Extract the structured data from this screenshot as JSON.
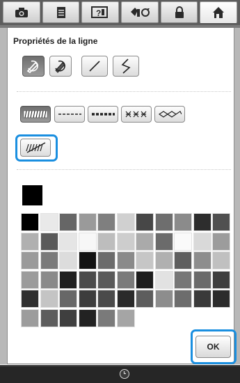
{
  "toolbar": {
    "tabs": [
      {
        "icon": "camera-icon"
      },
      {
        "icon": "page-icon"
      },
      {
        "icon": "help-icon"
      },
      {
        "icon": "settings-icon"
      },
      {
        "icon": "lock-icon"
      },
      {
        "icon": "home-icon",
        "active": true
      }
    ]
  },
  "dialog": {
    "title": "Propriétés de la ligne",
    "tools": [
      {
        "icon": "pen-select-icon",
        "selected": true
      },
      {
        "icon": "pen-fill-icon",
        "selected": false
      },
      {
        "icon": "straight-line-icon",
        "selected": false
      },
      {
        "icon": "zigzag-line-icon",
        "selected": false
      }
    ],
    "stitch_types": [
      {
        "icon": "satin-stitch-icon",
        "selected": true
      },
      {
        "icon": "running-stitch-icon",
        "selected": false
      },
      {
        "icon": "triple-stitch-icon",
        "selected": false
      },
      {
        "icon": "cross-stitch-icon",
        "selected": false
      },
      {
        "icon": "candlewick-stitch-icon",
        "selected": false
      },
      {
        "icon": "no-stitch-icon",
        "selected": false,
        "highlighted": true
      }
    ],
    "current_color": "#000000",
    "palette": [
      "#000000",
      "#e9e9e9",
      "#666666",
      "#9a9a9a",
      "#7f7f7f",
      "#d0d0d0",
      "#474747",
      "#6e6e6e",
      "#8b8b8b",
      "#2d2d2d",
      "#505050",
      "#b0b0b0",
      "#5a5a5a",
      "#e5e5e5",
      "#f7f7f7",
      "#bdbdbd",
      "#cdcdcd",
      "#aaaaaa",
      "#6b6b6b",
      "#fafafa",
      "#d9d9d9",
      "#9c9c9c",
      "#9a9a9a",
      "#7a7a7a",
      "#dcdcdc",
      "#121212",
      "#6c6c6c",
      "#8a8a8a",
      "#c6c6c6",
      "#b0b0b0",
      "#5e5e5e",
      "#8d8d8d",
      "#c0c0c0",
      "#9b9b9b",
      "#8a8a8a",
      "#202020",
      "#4b4b4b",
      "#5a5a5a",
      "#7a7a7a",
      "#1d1d1d",
      "#e2e2e2",
      "#777777",
      "#6a6a6a",
      "#3e3e3e",
      "#2f2f2f",
      "#c4c4c4",
      "#676767",
      "#3d3d3d",
      "#4a4a4a",
      "#2a2a2a",
      "#5d5d5d",
      "#8d8d8d",
      "#6d6d6d",
      "#3a3a3a",
      "#2c2c2c",
      "#9c9c9c",
      "#5d5d5d",
      "#3f3f3f",
      "#222222",
      "#7a7a7a",
      "#a5a5a5"
    ],
    "ok_label": "OK"
  },
  "status": {
    "icon": "clock-icon"
  }
}
